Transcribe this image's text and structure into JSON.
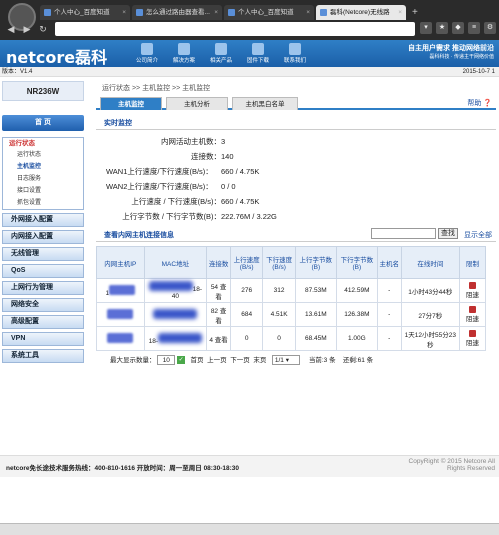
{
  "browser": {
    "tabs": [
      {
        "label": "个人中心_百度知道",
        "active": false
      },
      {
        "label": "怎么通过路由器查看...",
        "active": false
      },
      {
        "label": "个人中心_百度知道",
        "active": false
      },
      {
        "label": "磊科(Netcore)无线路",
        "active": true
      }
    ],
    "new_tab": "+"
  },
  "header": {
    "brand": "netcore磊科",
    "nav": [
      "公司简介",
      "解决方案",
      "相关产品",
      "固件下载",
      "联系我们"
    ],
    "hotline_title": "自主用户需求 推动网络前沿",
    "hotline_sub": "磊科科技 · 传递主干网络价值"
  },
  "subbar": {
    "version": "版本：V1.4",
    "date": "2015-10-7 1"
  },
  "sidebar": {
    "model": "NR236W",
    "home": "首 页",
    "run_status": "运行状态",
    "run_items": [
      "运行状态",
      "主机监控",
      "日志服务",
      "接口设置",
      "抓包设置"
    ],
    "menus": [
      "外网接入配置",
      "内网接入配置",
      "无线管理",
      "QoS",
      "上网行为管理",
      "网络安全",
      "高级配置",
      "VPN",
      "系统工具"
    ]
  },
  "main": {
    "breadcrumb": "运行状态 >> 主机监控 >> 主机监控",
    "tabs": [
      "主机监控",
      "主机分析",
      "主机黑白名单"
    ],
    "help": "帮助",
    "realtime_title": "实时监控",
    "stats": [
      {
        "label": "内网活动主机数：",
        "value": "3"
      },
      {
        "label": "连接数：",
        "value": "140"
      },
      {
        "label": "WAN1上行速度/下行速度(B/s)：",
        "value": "660  /  4.75K"
      },
      {
        "label": "WAN2上行速度/下行速度(B/s)：",
        "value": "0  /  0"
      },
      {
        "label": "上行速度 / 下行速度(B/s)：",
        "value": "660  /  4.75K"
      },
      {
        "label": "上行字节数 / 下行字节数(B)：",
        "value": "222.76M  /  3.22G"
      }
    ],
    "conn_title": "查看内网主机连接信息",
    "search_btn": "查找",
    "show_all": "显示全部",
    "columns": [
      "内网主机IP",
      "MAC地址",
      "连接数",
      "上行速度(B/s)",
      "下行速度(B/s)",
      "上行字节数(B)",
      "下行字节数(B)",
      "主机名",
      "在线时间",
      "限制"
    ],
    "rows": [
      {
        "ip": "1",
        "mac": "18-40",
        "conns": "54 查看",
        "up": "276",
        "down": "312",
        "upb": "87.53M",
        "downb": "412.59M",
        "name": "-",
        "online": "1小时43分44秒",
        "limit": "阻速"
      },
      {
        "ip": "",
        "mac": "",
        "conns": "82 查看",
        "up": "684",
        "down": "4.51K",
        "upb": "13.61M",
        "downb": "126.38M",
        "name": "-",
        "online": "27分7秒",
        "limit": "阻速"
      },
      {
        "ip": "",
        "mac": "18-",
        "conns": "4 查看",
        "up": "0",
        "down": "0",
        "upb": "68.45M",
        "downb": "1.00G",
        "name": "-",
        "online": "1天12小时55分23秒",
        "limit": "阻速"
      }
    ],
    "pager": {
      "max_label": "最大显示数量：",
      "max_value": "10",
      "first": "首页",
      "prev": "上一页",
      "next": "下一页",
      "last": "末页",
      "page": "1/1",
      "current": "当前:3 条",
      "total": "还剩:61 条"
    }
  },
  "footer": {
    "support": "netcore免长途技术服务热线：400-810-1616   开放时间：周一至周日 08:30-18:30",
    "copyright": "CopyRight © 2015 Netcore All Rights Reserved"
  }
}
